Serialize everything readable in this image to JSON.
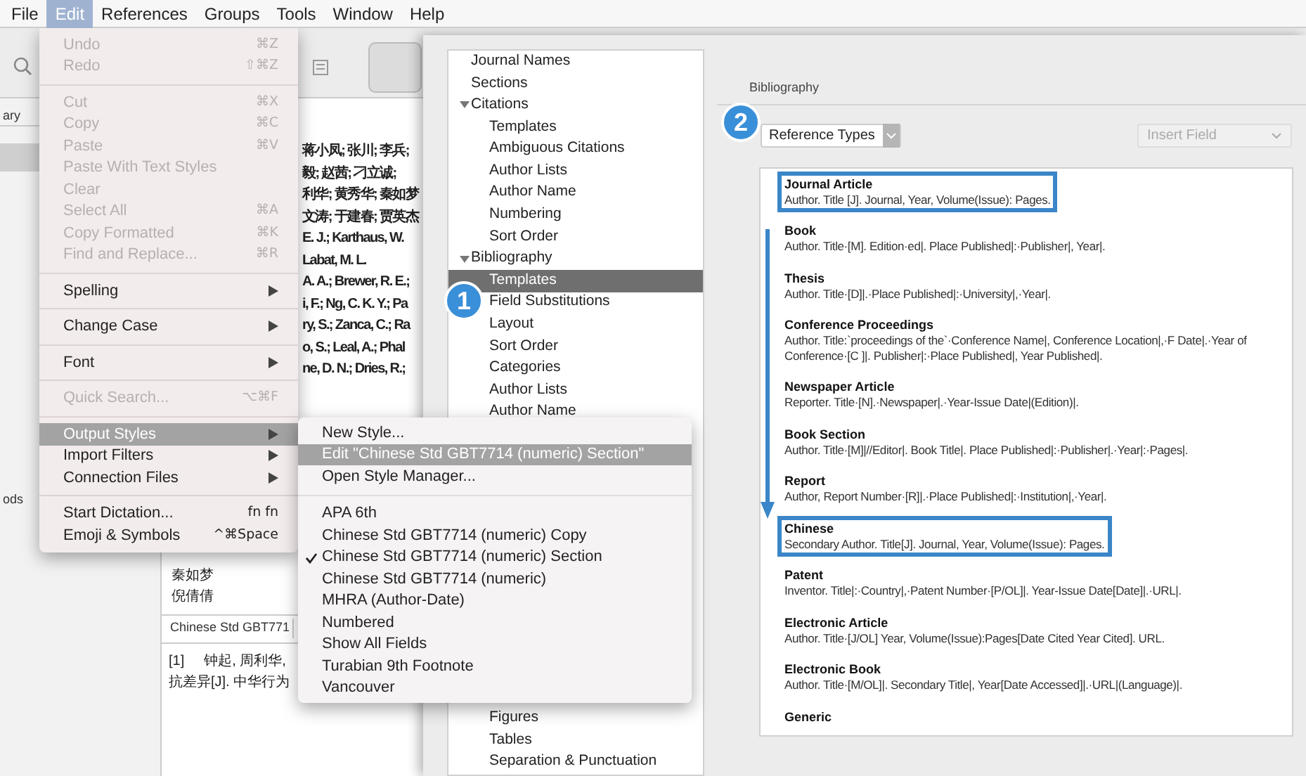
{
  "menu_bar": [
    {
      "label": "File",
      "selected": false
    },
    {
      "label": "Edit",
      "selected": true
    },
    {
      "label": "References",
      "selected": false
    },
    {
      "label": "Groups",
      "selected": false
    },
    {
      "label": "Tools",
      "selected": false
    },
    {
      "label": "Window",
      "selected": false
    },
    {
      "label": "Help",
      "selected": false
    }
  ],
  "library": {
    "sidebar_fragments": [
      "ary",
      "ods"
    ],
    "author_fragments": [
      "蒋小凤; 张川; 李兵;",
      "毅; 赵茜; 刁立诚;",
      "利华; 黄秀华; 秦如梦",
      "文涛; 于建春; 贾英杰",
      "E. J.; Karthaus, W.",
      "Labat, M. L.",
      "A. A.; Brewer, R. E.;",
      "i, F.; Ng, C. K. Y.; Pa",
      "ry, S.; Zanca, C.; Ra",
      "o, S.; Leal, A.; Phal",
      "ne, D. N.; Dries, R.;"
    ],
    "authors": [
      "秦如梦",
      "倪倩倩"
    ],
    "style_selector": "Chinese Std GBT771",
    "preview": {
      "number": "[1]",
      "lines": [
        "钟起, 周利华,",
        "抗差异[J]. 中华行为"
      ]
    }
  },
  "edit_menu": [
    {
      "kind": "item",
      "label": "Undo",
      "shortcut": "⌘Z",
      "disabled": true,
      "selected": false
    },
    {
      "kind": "item",
      "label": "Redo",
      "shortcut": "⇧⌘Z",
      "disabled": true,
      "selected": false
    },
    {
      "kind": "separator"
    },
    {
      "kind": "item",
      "label": "Cut",
      "shortcut": "⌘X",
      "disabled": true,
      "selected": false
    },
    {
      "kind": "item",
      "label": "Copy",
      "shortcut": "⌘C",
      "disabled": true,
      "selected": false
    },
    {
      "kind": "item",
      "label": "Paste",
      "shortcut": "⌘V",
      "disabled": true,
      "selected": false
    },
    {
      "kind": "item",
      "label": "Paste With Text Styles",
      "disabled": true,
      "selected": false
    },
    {
      "kind": "item",
      "label": "Clear",
      "disabled": true,
      "selected": false
    },
    {
      "kind": "item",
      "label": "Select All",
      "shortcut": "⌘A",
      "disabled": true,
      "selected": false
    },
    {
      "kind": "item",
      "label": "Copy Formatted",
      "shortcut": "⌘K",
      "disabled": true,
      "selected": false
    },
    {
      "kind": "item",
      "label": "Find and Replace...",
      "shortcut": "⌘R",
      "disabled": true,
      "selected": false
    },
    {
      "kind": "separator"
    },
    {
      "kind": "submenu",
      "label": "Spelling",
      "disabled": false,
      "selected": false
    },
    {
      "kind": "separator"
    },
    {
      "kind": "submenu",
      "label": "Change Case",
      "disabled": false,
      "selected": false
    },
    {
      "kind": "separator"
    },
    {
      "kind": "submenu",
      "label": "Font",
      "disabled": false,
      "selected": false
    },
    {
      "kind": "separator"
    },
    {
      "kind": "item",
      "label": "Quick Search...",
      "shortcut": "⌥⌘F",
      "disabled": true,
      "selected": false
    },
    {
      "kind": "separator"
    },
    {
      "kind": "submenu",
      "label": "Output Styles",
      "disabled": false,
      "selected": true
    },
    {
      "kind": "submenu",
      "label": "Import Filters",
      "disabled": false,
      "selected": false
    },
    {
      "kind": "submenu",
      "label": "Connection Files",
      "disabled": false,
      "selected": false
    },
    {
      "kind": "separator"
    },
    {
      "kind": "item",
      "label": "Start Dictation...",
      "shortcut": "fn fn",
      "disabled": false,
      "selected": false
    },
    {
      "kind": "item",
      "label": "Emoji & Symbols",
      "shortcut": "^⌘Space",
      "disabled": false,
      "selected": false
    }
  ],
  "styles_menu": {
    "actions": [
      {
        "label": "New Style...",
        "selected": false
      },
      {
        "label": "Edit \"Chinese Std GBT7714 (numeric) Section\"",
        "selected": true
      },
      {
        "label": "Open Style Manager...",
        "selected": false
      }
    ],
    "styles": [
      {
        "label": "APA 6th",
        "checked": false
      },
      {
        "label": "Chinese Std GBT7714 (numeric) Copy",
        "checked": false
      },
      {
        "label": "Chinese Std GBT7714 (numeric) Section",
        "checked": true
      },
      {
        "label": "Chinese Std GBT7714 (numeric)",
        "checked": false
      },
      {
        "label": "MHRA (Author-Date)",
        "checked": false
      },
      {
        "label": "Numbered",
        "checked": false
      },
      {
        "label": "Show All Fields",
        "checked": false
      },
      {
        "label": "Turabian 9th Footnote",
        "checked": false
      },
      {
        "label": "Vancouver",
        "checked": false
      }
    ]
  },
  "tree": [
    {
      "label": "Journal Names",
      "selected": false
    },
    {
      "label": "Sections",
      "selected": false
    },
    {
      "label": "Citations",
      "selected": false,
      "expanded": true,
      "children": [
        {
          "label": "Templates",
          "selected": false
        },
        {
          "label": "Ambiguous Citations",
          "selected": false
        },
        {
          "label": "Author Lists",
          "selected": false
        },
        {
          "label": "Author Name",
          "selected": false
        },
        {
          "label": "Numbering",
          "selected": false
        },
        {
          "label": "Sort Order",
          "selected": false
        }
      ]
    },
    {
      "label": "Bibliography",
      "selected": false,
      "expanded": true,
      "children": [
        {
          "label": "Templates",
          "selected": true
        },
        {
          "label": "Field Substitutions",
          "selected": false
        },
        {
          "label": "Layout",
          "selected": false
        },
        {
          "label": "Sort Order",
          "selected": false
        },
        {
          "label": "Categories",
          "selected": false
        },
        {
          "label": "Author Lists",
          "selected": false
        },
        {
          "label": "Author Name",
          "selected": false
        }
      ]
    }
  ],
  "tree_tail": [
    {
      "label": "Figures",
      "selected": false
    },
    {
      "label": "Tables",
      "selected": false
    },
    {
      "label": "Separation & Punctuation",
      "selected": false
    }
  ],
  "badges": [
    "1",
    "2"
  ],
  "editor": {
    "section_title": "Bibliography",
    "reference_types": "Reference Types",
    "insert_field": {
      "label": "Insert Field",
      "disabled": true
    },
    "templates": [
      {
        "name": "Journal Article",
        "template": "Author. Title [J]. Journal, Year, Volume(Issue): Pages.",
        "highlighted": true
      },
      {
        "name": "Book",
        "template": "Author. Title·[M]. Edition·ed|. Place Published|:·Publisher|, Year|.",
        "highlighted": false
      },
      {
        "name": "Thesis",
        "template": "Author. Title·[D]|.·Place Published|:·University|,·Year|.",
        "highlighted": false
      },
      {
        "name": "Conference Proceedings",
        "template": "Author. Title:`proceedings of the`·Conference Name|, Conference Location|,·F Date|.·Year of Conference·[C ]|. Publisher|:·Place Published|, Year Published|.",
        "highlighted": false
      },
      {
        "name": "Newspaper Article",
        "template": "Reporter. Title·[N].·Newspaper|.·Year-Issue Date|(Edition)|.",
        "highlighted": false
      },
      {
        "name": "Book Section",
        "template": "Author. Title·[M]|//Editor|. Book Title|. Place Published|:·Publisher|.·Year|:·Pages|.",
        "highlighted": false
      },
      {
        "name": "Report",
        "template": "Author, Report Number·[R]|.·Place Published|:·Institution|,·Year|.",
        "highlighted": false
      },
      {
        "name": "Chinese",
        "template": "Secondary Author. Title[J]. Journal, Year, Volume(Issue): Pages.",
        "highlighted": true
      },
      {
        "name": "Patent",
        "template": "Inventor. Title|:·Country|,·Patent Number·[P/OL]|. Year-Issue Date[Date]|.·URL|.",
        "highlighted": false
      },
      {
        "name": "Electronic Article",
        "template": "Author. Title·[J/OL] Year, Volume(Issue):Pages[Date Cited Year Cited]. URL.",
        "highlighted": false
      },
      {
        "name": "Electronic Book",
        "template": "Author. Title·[M/OL]|. Secondary Title|, Year[Date Accessed]|.·URL|(Language)|.",
        "highlighted": false
      },
      {
        "name": "Generic",
        "highlighted": false
      }
    ]
  }
}
